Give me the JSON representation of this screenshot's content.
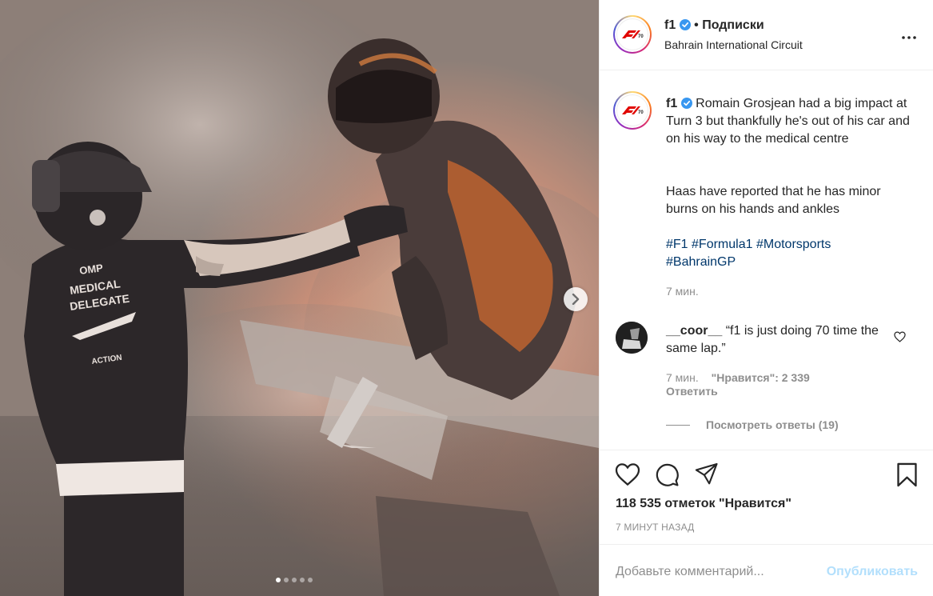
{
  "post": {
    "author": {
      "username": "f1",
      "verified": true,
      "avatar_logo_text": "F1 70",
      "follow_separator": "•",
      "follow_label": "Подписки",
      "location": "Bahrain International Circuit"
    },
    "media": {
      "slides_total": 5,
      "active_slide": 1,
      "next_icon": "chevron-right-icon",
      "photo_text": {
        "badge_1": "OMP",
        "line_1": "MEDICAL",
        "line_2": "DELEGATE",
        "badge_2": "ACTION"
      }
    },
    "caption": {
      "username": "f1",
      "text_1": "Romain Grosjean had a big impact at Turn 3 but thankfully he's out of his car and on his way to the medical centre",
      "text_2": "Haas have reported that he has minor burns on his hands and ankles",
      "hashtags": [
        "#F1",
        "#Formula1",
        "#Motorsports",
        "#BahrainGP"
      ],
      "time": "7 мин."
    },
    "comments": [
      {
        "username": "__coor__",
        "text": "“f1 is just doing 70 time the same lap.”",
        "time": "7 мин.",
        "likes_label": "\"Нравится\": 2 339",
        "reply_label": "Ответить",
        "view_replies_label": "Посмотреть ответы (19)"
      }
    ],
    "actions": {
      "like_icon": "heart-icon",
      "comment_icon": "comment-icon",
      "share_icon": "paper-plane-icon",
      "save_icon": "bookmark-icon"
    },
    "likes_text": "118 535 отметок \"Нравится\"",
    "time_ago": "7 МИНУТ НАЗАД",
    "comment_form": {
      "placeholder": "Добавьте комментарий...",
      "publish_label": "Опубликовать"
    }
  },
  "colors": {
    "verified_blue": "#3897f0",
    "publish_disabled": "#b2dffc",
    "hashtag": "#00376b",
    "f1_red": "#e10600"
  }
}
